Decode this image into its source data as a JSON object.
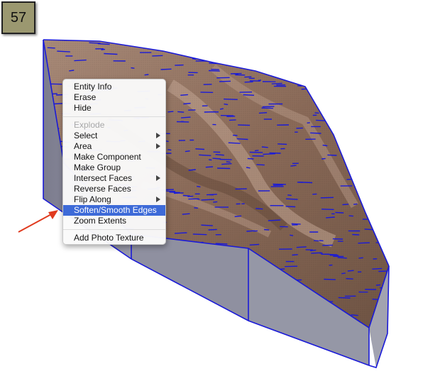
{
  "step_badge": {
    "number": "57"
  },
  "context_menu": {
    "groups": [
      [
        {
          "label": "Entity Info",
          "enabled": true,
          "submenu": false
        },
        {
          "label": "Erase",
          "enabled": true,
          "submenu": false
        },
        {
          "label": "Hide",
          "enabled": true,
          "submenu": false
        }
      ],
      [
        {
          "label": "Explode",
          "enabled": false,
          "submenu": false
        },
        {
          "label": "Select",
          "enabled": true,
          "submenu": true
        },
        {
          "label": "Area",
          "enabled": true,
          "submenu": true
        },
        {
          "label": "Make Component",
          "enabled": true,
          "submenu": false
        },
        {
          "label": "Make Group",
          "enabled": true,
          "submenu": false
        },
        {
          "label": "Intersect Faces",
          "enabled": true,
          "submenu": true
        },
        {
          "label": "Reverse Faces",
          "enabled": true,
          "submenu": false
        },
        {
          "label": "Flip Along",
          "enabled": true,
          "submenu": true
        },
        {
          "label": "Soften/Smooth Edges",
          "enabled": true,
          "submenu": false,
          "selected": true
        },
        {
          "label": "Zoom Extents",
          "enabled": true,
          "submenu": false
        }
      ],
      [
        {
          "label": "Add Photo Texture",
          "enabled": true,
          "submenu": false
        }
      ]
    ]
  },
  "colors": {
    "terrain": "#8a6a58",
    "edges": "#1a1ad8",
    "side_faces": "#8d8e9e",
    "annotation_arrow": "#e03a1e",
    "menu_highlight": "#3d6ad8"
  }
}
